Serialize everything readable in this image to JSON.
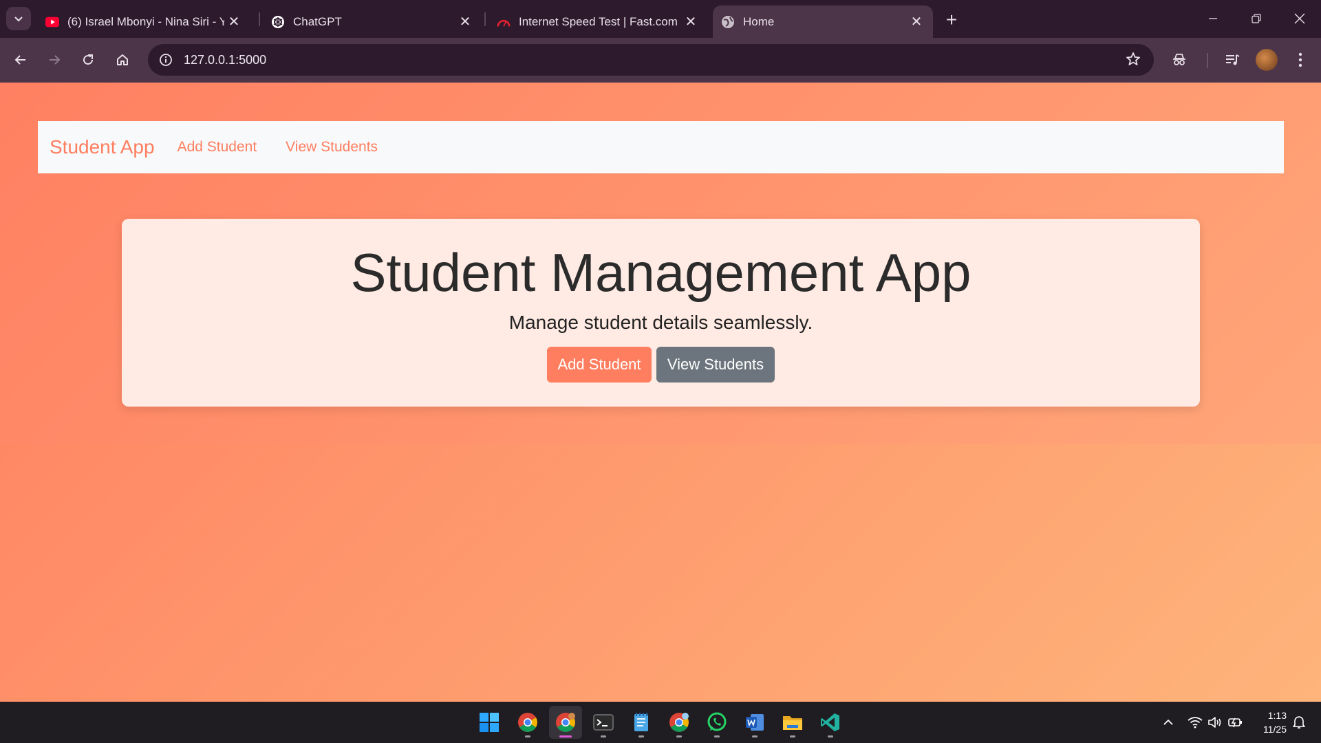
{
  "browser": {
    "tabs": [
      {
        "title": "(6) Israel Mbonyi - Nina Siri - Yo",
        "favicon": "youtube-icon"
      },
      {
        "title": "ChatGPT",
        "favicon": "chatgpt-icon"
      },
      {
        "title": "Internet Speed Test | Fast.com",
        "favicon": "fast-speedometer-icon"
      },
      {
        "title": "Home",
        "favicon": "globe-icon",
        "active": true
      }
    ],
    "url": "127.0.0.1:5000"
  },
  "page": {
    "navbar": {
      "brand": "Student App",
      "links": [
        "Add Student",
        "View Students"
      ]
    },
    "hero": {
      "title": "Student Management App",
      "subtitle": "Manage student details seamlessly.",
      "primary_button": "Add Student",
      "secondary_button": "View Students"
    },
    "colors": {
      "accent": "#ff7e5f",
      "gradient_end": "#feb47b",
      "secondary_button": "#6c757d"
    }
  },
  "taskbar": {
    "apps": [
      "start-icon",
      "chrome-icon",
      "chrome-profile-icon",
      "terminal-icon",
      "notepad-icon",
      "chrome-alt-icon",
      "whatsapp-icon",
      "word-icon",
      "file-explorer-icon",
      "vscode-icon"
    ],
    "time": "1:13",
    "date": "11/25"
  }
}
